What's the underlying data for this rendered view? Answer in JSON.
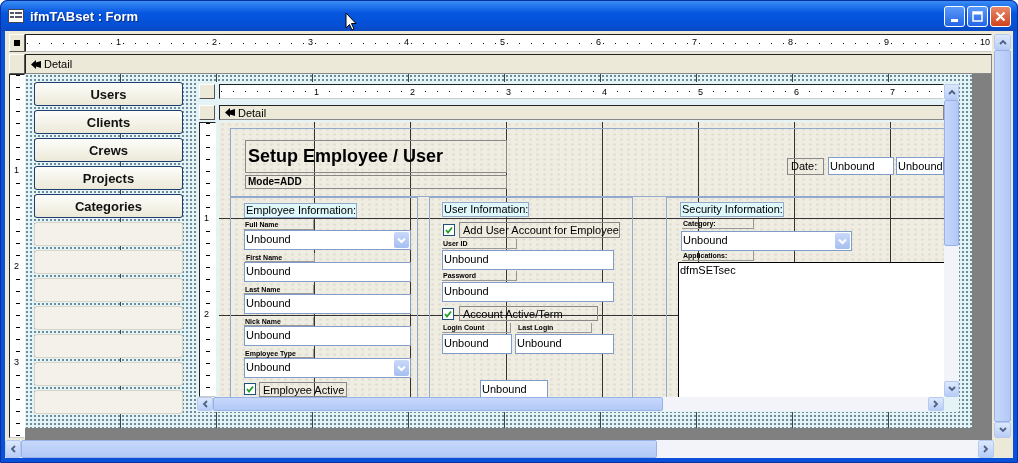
{
  "window": {
    "title": "ifmTABset : Form"
  },
  "ruler": {
    "marks": [
      "1",
      "2",
      "3",
      "4",
      "5",
      "6",
      "7",
      "8",
      "9",
      "10"
    ]
  },
  "section": {
    "label": "Detail"
  },
  "vertical_ruler": {
    "marks": [
      "1",
      "2",
      "3"
    ]
  },
  "buttons": [
    {
      "kind": "command",
      "label": "Users"
    },
    {
      "kind": "command",
      "label": "Clients"
    },
    {
      "kind": "command",
      "label": "Crews"
    },
    {
      "kind": "command",
      "label": "Projects"
    },
    {
      "kind": "command",
      "label": "Categories"
    },
    {
      "kind": "blank"
    },
    {
      "kind": "blank"
    },
    {
      "kind": "blank"
    },
    {
      "kind": "blank"
    },
    {
      "kind": "blank"
    },
    {
      "kind": "blank"
    },
    {
      "kind": "blank"
    }
  ],
  "subform": {
    "ruler": {
      "marks": [
        "1",
        "2",
        "3",
        "4",
        "5",
        "6",
        "7"
      ]
    },
    "section": {
      "label": "Detail"
    },
    "vertical_ruler": {
      "marks": [
        "1",
        "2"
      ]
    },
    "controls": [
      {
        "kind": "title",
        "text": "Setup Employee / User"
      },
      {
        "kind": "mode",
        "text": "Mode=ADD"
      },
      {
        "kind": "field_label",
        "text": "Date:"
      },
      {
        "kind": "textbox",
        "text": "Unbound"
      },
      {
        "kind": "textbox",
        "text": "Unbound"
      },
      {
        "kind": "caption",
        "text": "Employee Information:"
      },
      {
        "kind": "small_label",
        "text": "Full Name"
      },
      {
        "kind": "combo",
        "text": "Unbound"
      },
      {
        "kind": "small_label",
        "text": "First Name"
      },
      {
        "kind": "textbox",
        "text": "Unbound"
      },
      {
        "kind": "small_label",
        "text": "Last Name"
      },
      {
        "kind": "textbox",
        "text": "Unbound"
      },
      {
        "kind": "small_label",
        "text": "Nick Name"
      },
      {
        "kind": "textbox",
        "text": "Unbound"
      },
      {
        "kind": "small_label",
        "text": "Employee Type"
      },
      {
        "kind": "combo",
        "text": "Unbound"
      },
      {
        "kind": "checkbox",
        "checked": true
      },
      {
        "kind": "field_label",
        "text": "Employee Active"
      },
      {
        "kind": "caption",
        "text": "User Information:"
      },
      {
        "kind": "checkbox",
        "checked": true
      },
      {
        "kind": "field_label",
        "text": "Add User Account for Employee"
      },
      {
        "kind": "small_label",
        "text": "User ID"
      },
      {
        "kind": "textbox",
        "text": "Unbound"
      },
      {
        "kind": "small_label",
        "text": "Password"
      },
      {
        "kind": "textbox",
        "text": "Unbound"
      },
      {
        "kind": "checkbox",
        "checked": true
      },
      {
        "kind": "field_label",
        "text": "Account Active/Term"
      },
      {
        "kind": "small_label",
        "text": "Login Count"
      },
      {
        "kind": "small_label",
        "text": "Last Login"
      },
      {
        "kind": "textbox",
        "text": "Unbound"
      },
      {
        "kind": "textbox",
        "text": "Unbound"
      },
      {
        "kind": "textbox",
        "text": "Unbound"
      },
      {
        "kind": "caption",
        "text": "Security Information:"
      },
      {
        "kind": "small_label",
        "text": "Category:"
      },
      {
        "kind": "combo",
        "text": "Unbound"
      },
      {
        "kind": "small_label",
        "text": "Applications:"
      },
      {
        "kind": "subform",
        "text": "dfmSETsec"
      }
    ]
  }
}
